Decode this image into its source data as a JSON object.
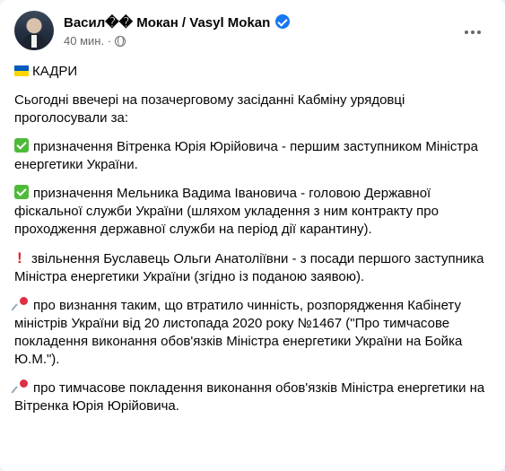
{
  "post": {
    "author": "Васил�� Мокан / Vasyl Mokan",
    "time": "40 мин.",
    "time_separator": "·"
  },
  "icons": {
    "avatar": "profile-photo",
    "verified": "verified-badge-icon",
    "privacy": "globe-icon",
    "more": "more-horizontal-icon",
    "flag": "ukraine-flag-icon",
    "check": "check-mark-button-icon",
    "exclamation": "red-exclamation-icon",
    "pin": "pushpin-icon"
  },
  "colors": {
    "link_blue": "#1877f2",
    "text": "#050505",
    "secondary": "#65676b",
    "check_green": "#4fba3a",
    "exclamation_red": "#e0242c",
    "flag_blue": "#005bbb",
    "flag_yellow": "#ffd500"
  },
  "content": {
    "heading": "КАДРИ",
    "intro": "Сьогодні ввечері на позачерговому засіданні Кабміну урядовці проголосували за:",
    "item1": "призначення Вітренка Юрія Юрійовича - першим заступником Міністра енергетики України.",
    "item2": "призначення Мельника Вадима Івановича - головою Державної фіскальної служби України (шляхом укладення з ним контракту про проходження державної служби на період дії карантину).",
    "item3": "звільнення Буславець Ольги Анатоліївни - з посади першого заступника Міністра енергетики України (згідно із поданою заявою).",
    "item4": "про визнання таким, що втратило чинність, розпорядження Кабінету міністрів України від 20 листопада 2020 року №1467 (\"Про тимчасове покладення виконання обов'язків Міністра енергетики України на Бойка Ю.М.\").",
    "item5": "про тимчасове покладення виконання обов'язків Міністра енергетики на Вітренка Юрія Юрійовича."
  }
}
